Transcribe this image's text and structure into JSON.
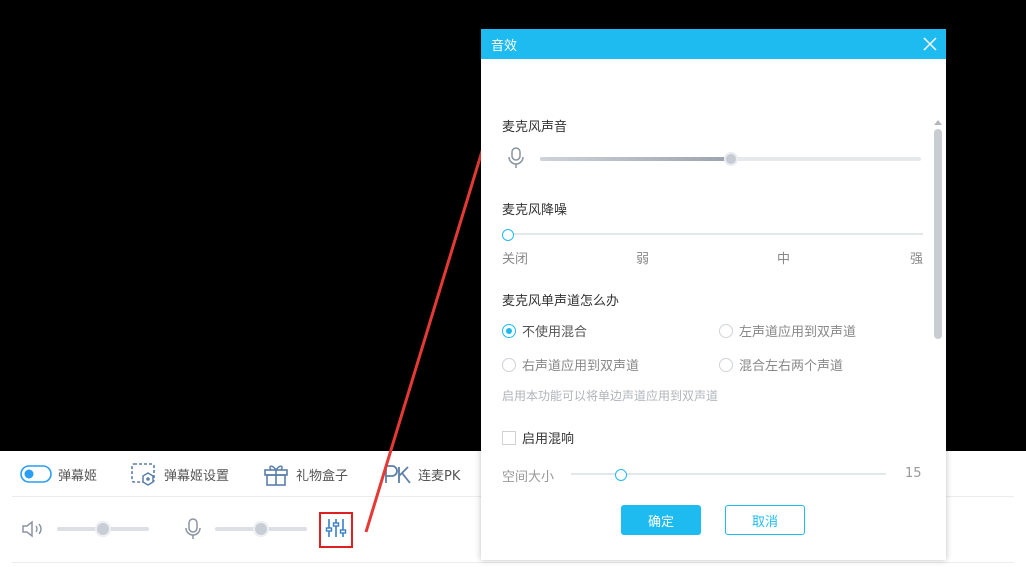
{
  "toolbar_top": {
    "items": [
      {
        "label": "弹幕姬",
        "icon": "toggle-icon"
      },
      {
        "label": "弹幕姬设置",
        "icon": "danmaku-settings-icon"
      },
      {
        "label": "礼物盒子",
        "icon": "gift-icon"
      },
      {
        "label": "连麦PK",
        "icon": "pk-icon"
      }
    ]
  },
  "toolbar_bottom": {
    "speaker_volume": 0.5,
    "mic_volume": 0.5,
    "icons": [
      "speaker-icon",
      "microphone-icon",
      "equalizer-icon"
    ]
  },
  "dialog": {
    "title": "音效",
    "mic_volume": {
      "title": "麦克风声音",
      "value": 0.5
    },
    "noise": {
      "title": "麦克风降噪",
      "levels": [
        "关闭",
        "弱",
        "中",
        "强"
      ],
      "selected": "关闭"
    },
    "mono": {
      "title": "麦克风单声道怎么办",
      "options": [
        "不使用混合",
        "左声道应用到双声道",
        "右声道应用到双声道",
        "混合左右两个声道"
      ],
      "selected": "不使用混合",
      "hint": "启用本功能可以将单边声道应用到双声道"
    },
    "reverb": {
      "checkbox_label": "启用混响",
      "room_size_label": "空间大小",
      "room_size_value": "15",
      "room_size_fraction": 0.16
    },
    "ok_label": "确定",
    "cancel_label": "取消"
  },
  "colors": {
    "accent": "#1ebbf0",
    "annotation": "#e02020"
  }
}
